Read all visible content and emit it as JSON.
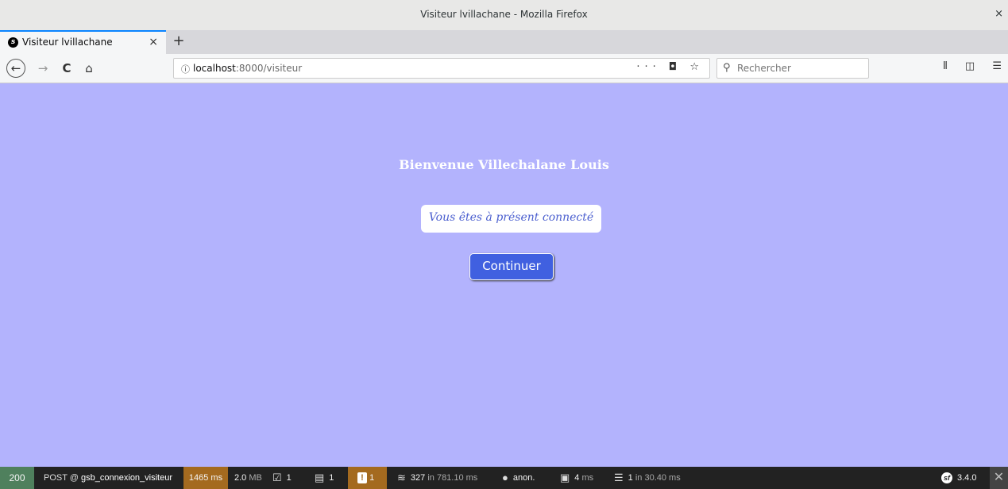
{
  "window": {
    "title": "Visiteur lvillachane - Mozilla Firefox",
    "close": "×"
  },
  "tab": {
    "label": "Visiteur lvillachane",
    "close": "×",
    "new_tab": "+"
  },
  "nav": {
    "back": "←",
    "forward": "→",
    "reload": "C",
    "home": "⌂",
    "url_host": "localhost",
    "url_rest": ":8000/visiteur",
    "url_actions": "··· ◘ ☆",
    "search_placeholder": "Rechercher"
  },
  "page": {
    "welcome": "Bienvenue Villechalane Louis",
    "message": "Vous êtes à présent connecté",
    "continue_label": "Continuer",
    "background_color": "#b3b3fd",
    "button_color": "#4060e0"
  },
  "debug_toolbar": {
    "status": "200",
    "method": "POST @",
    "route": "gsb_connexion_visiteur",
    "time": "1465 ms",
    "memory": "2.0",
    "memory_unit": "MB",
    "forms": "1",
    "logs": "1",
    "warnings": "1",
    "twig_count": "327",
    "twig_time": "in 781.10 ms",
    "user": "anon.",
    "cache": "4",
    "cache_unit": "ms",
    "db_count": "1",
    "db_time": "in 30.40 ms",
    "version": "3.4.0",
    "close": "✕"
  }
}
